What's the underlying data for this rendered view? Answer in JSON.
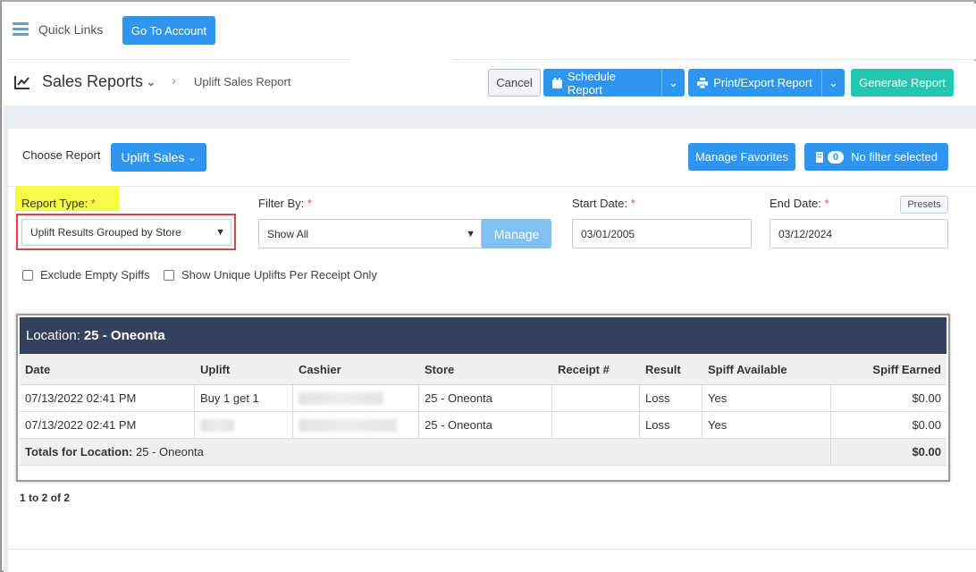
{
  "topbar": {
    "quick_links": "Quick Links",
    "go_to_account": "Go To Account"
  },
  "header": {
    "title": "Sales Reports",
    "breadcrumb_current": "Uplift Sales Report",
    "cancel": "Cancel",
    "schedule_report": "Schedule Report",
    "print_export": "Print/Export Report",
    "generate_report": "Generate Report"
  },
  "report": {
    "choose_label": "Choose Report",
    "selected": "Uplift Sales",
    "manage_favorites": "Manage Favorites",
    "filter_count": "0",
    "filter_text": "No filter selected"
  },
  "filters": {
    "report_type_label": "Report Type:",
    "report_type_value": "Uplift Results Grouped by Store",
    "filter_by_label": "Filter By:",
    "filter_by_value": "Show All",
    "manage": "Manage",
    "start_date_label": "Start Date:",
    "start_date_value": "03/01/2005",
    "end_date_label": "End Date:",
    "end_date_value": "03/12/2024",
    "presets": "Presets",
    "required_mark": "*",
    "exclude_empty_spiffs": "Exclude Empty Spiffs",
    "show_unique": "Show Unique Uplifts Per Receipt Only"
  },
  "table": {
    "location_label": "Location:",
    "location_value": "25 - Oneonta",
    "columns": [
      "Date",
      "Uplift",
      "Cashier",
      "Store",
      "Receipt #",
      "Result",
      "Spiff Available",
      "Spiff Earned"
    ],
    "rows": [
      [
        "07/13/2022 02:41 PM",
        "Buy 1 get 1",
        "",
        "25 - Oneonta",
        "",
        "Loss",
        "Yes",
        "$0.00"
      ],
      [
        "07/13/2022 02:41 PM",
        "",
        "",
        "25 - Oneonta",
        "",
        "Loss",
        "Yes",
        "$0.00"
      ]
    ],
    "totals_label": "Totals for Location:",
    "totals_location": "25 - Oneonta",
    "totals_value": "$0.00"
  },
  "pager": "1 to 2 of 2",
  "colors": {
    "primary": "#2f96f0",
    "generate": "#22c7b0",
    "table_header": "#33415c",
    "highlight": "#f6fb46",
    "outline": "#e0443f"
  }
}
